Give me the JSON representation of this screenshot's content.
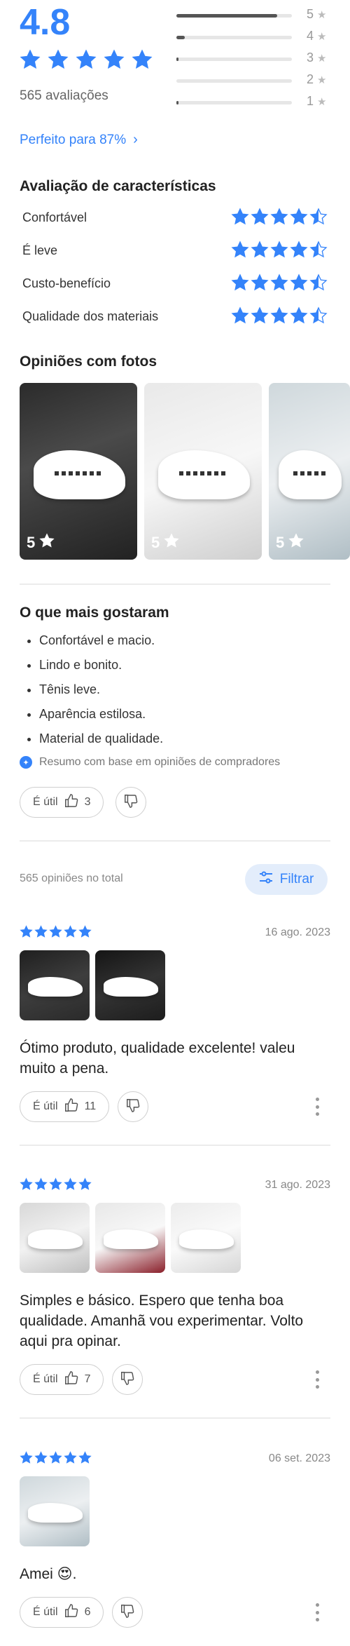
{
  "summary": {
    "average": "4.8",
    "average_stars": 5,
    "count_text": "565 avaliações",
    "distribution": [
      {
        "stars": "5",
        "fraction": 0.87
      },
      {
        "stars": "4",
        "fraction": 0.07
      },
      {
        "stars": "3",
        "fraction": 0.02
      },
      {
        "stars": "2",
        "fraction": 0.0
      },
      {
        "stars": "1",
        "fraction": 0.02
      }
    ],
    "fit_text": "Perfeito para 87%"
  },
  "features": {
    "title": "Avaliação de características",
    "items": [
      {
        "label": "Confortável",
        "rating": 4.5
      },
      {
        "label": "É leve",
        "rating": 4.5
      },
      {
        "label": "Custo-benefício",
        "rating": 4.5
      },
      {
        "label": "Qualidade dos materiais",
        "rating": 4.5
      }
    ]
  },
  "photos": {
    "title": "Opiniões com fotos",
    "items": [
      {
        "rating": "5"
      },
      {
        "rating": "5"
      },
      {
        "rating": "5"
      }
    ]
  },
  "highlights": {
    "title": "O que mais gostaram",
    "items": [
      "Confortável e macio.",
      "Lindo e bonito.",
      "Tênis leve.",
      "Aparência estilosa.",
      "Material de qualidade."
    ],
    "note": "Resumo com base em opiniões de compradores",
    "useful_label": "É útil",
    "useful_count": "3"
  },
  "reviews_header": {
    "total_text": "565 opiniões no total",
    "filter_label": "Filtrar"
  },
  "reviews": [
    {
      "stars": 5,
      "date": "16 ago. 2023",
      "text": "Ótimo produto, qualidade excelente! valeu muito a pena.",
      "useful_label": "É útil",
      "useful_count": "11",
      "photos": 2
    },
    {
      "stars": 5,
      "date": "31 ago. 2023",
      "text": "Simples e básico. Espero que tenha boa qualidade. Amanhã vou experimentar. Volto aqui pra opinar.",
      "useful_label": "É útil",
      "useful_count": "7",
      "photos": 3
    },
    {
      "stars": 5,
      "date": "06 set. 2023",
      "text": "Amei 😍.",
      "useful_label": "É útil",
      "useful_count": "6",
      "photos": 1
    }
  ],
  "colors": {
    "accent": "#3483fa",
    "star": "#3483fa",
    "text": "#222222",
    "muted": "#999999"
  }
}
